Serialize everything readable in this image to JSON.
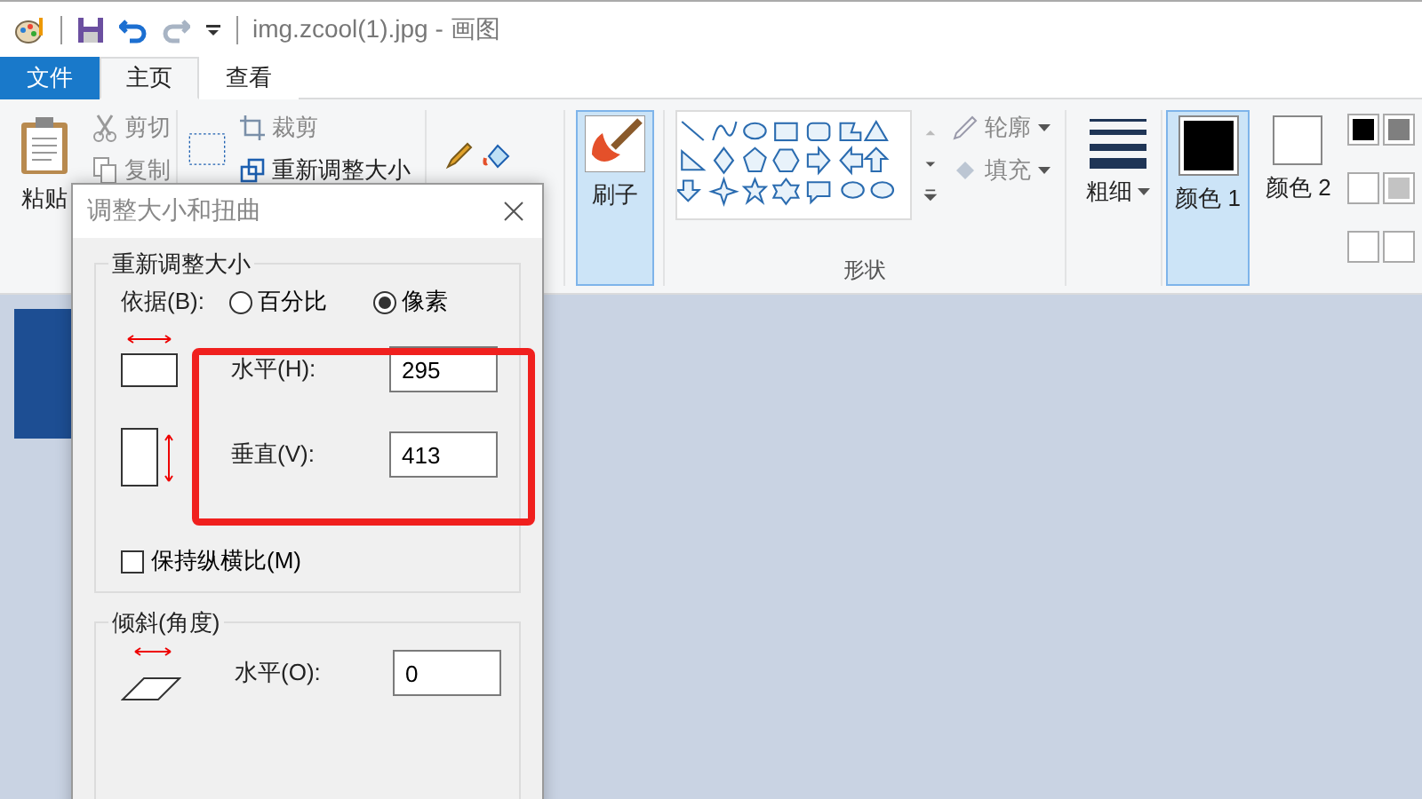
{
  "title_bar": {
    "title": "img.zcool(1).jpg - 画图"
  },
  "tabs": [
    {
      "label": "文件",
      "kind": "file",
      "selected": false
    },
    {
      "label": "主页",
      "kind": "tab",
      "selected": true
    },
    {
      "label": "查看",
      "kind": "tab",
      "selected": false
    }
  ],
  "ribbon": {
    "clipboard": {
      "paste": "粘贴",
      "cut": "剪切",
      "copy": "复制"
    },
    "image": {
      "crop": "裁剪",
      "resize": "重新调整大小"
    },
    "brushes": {
      "label": "刷子",
      "selected": true
    },
    "shapes": {
      "outline": "轮廓",
      "fill": "填充",
      "group_label": "形状"
    },
    "size": {
      "label": "粗细"
    },
    "colors": [
      {
        "label": "颜色 1",
        "color": "#000000",
        "selected": true
      },
      {
        "label": "颜色 2",
        "color": "#ffffff",
        "selected": false
      }
    ],
    "palette": [
      {
        "color": "#000000"
      },
      {
        "color": "#7f7f7f"
      },
      {
        "color": "#ffffff"
      },
      {
        "color": "#c3c3c3"
      }
    ]
  },
  "dialog": {
    "title": "调整大小和扭曲",
    "resize": {
      "legend": "重新调整大小",
      "by_label": "依据(B):",
      "options": [
        {
          "label": "百分比",
          "selected": false
        },
        {
          "label": "像素",
          "selected": true
        }
      ],
      "horizontal": {
        "label": "水平(H):",
        "value": "295"
      },
      "vertical": {
        "label": "垂直(V):",
        "value": "413"
      },
      "keep_ratio": {
        "label": "保持纵横比(M)",
        "checked": false
      }
    },
    "skew": {
      "legend": "倾斜(角度)",
      "horizontal": {
        "label": "水平(O):",
        "value": "0"
      }
    }
  }
}
